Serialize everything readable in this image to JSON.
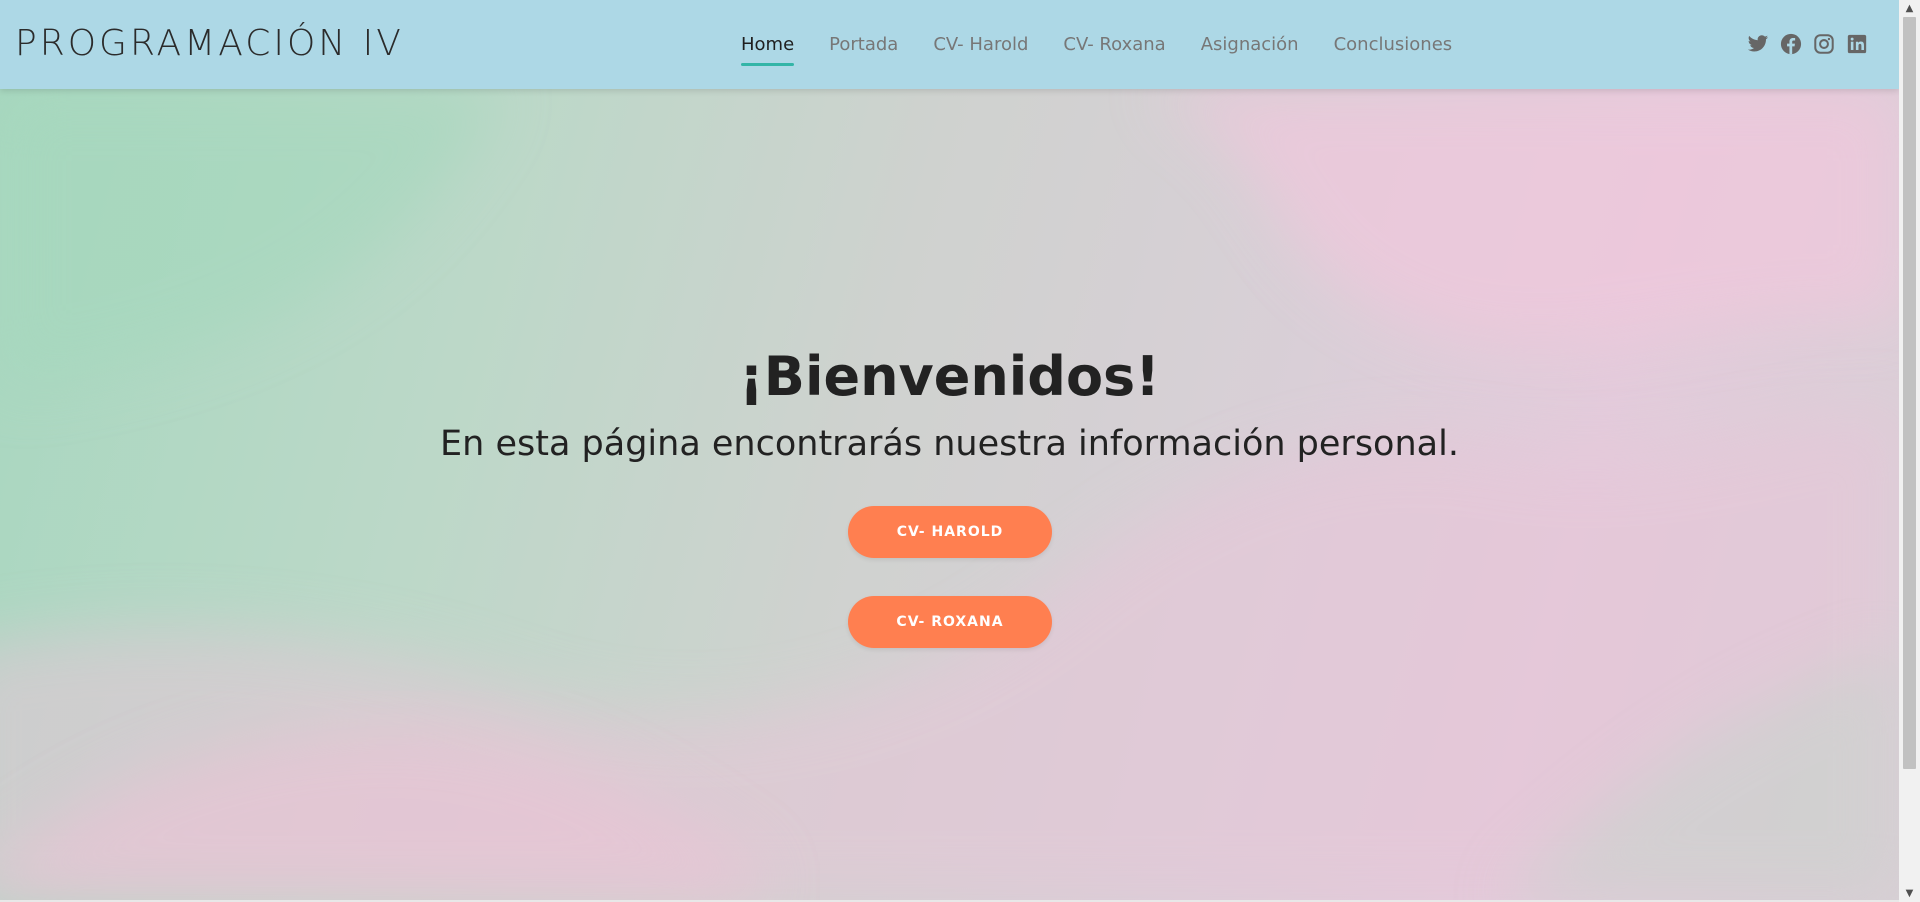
{
  "header": {
    "logo": "PROGRAMACIÓN IV",
    "nav": [
      {
        "label": "Home",
        "active": true
      },
      {
        "label": "Portada",
        "active": false
      },
      {
        "label": "CV- Harold",
        "active": false
      },
      {
        "label": "CV- Roxana",
        "active": false
      },
      {
        "label": "Asignación",
        "active": false
      },
      {
        "label": "Conclusiones",
        "active": false
      }
    ],
    "social_icons": [
      "twitter-icon",
      "facebook-icon",
      "instagram-icon",
      "linkedin-icon"
    ]
  },
  "hero": {
    "title": "¡Bienvenidos!",
    "subtitle": "En esta página encontrarás nuestra información personal.",
    "buttons": [
      {
        "label": "CV- HAROLD"
      },
      {
        "label": "CV- ROXANA"
      }
    ]
  },
  "colors": {
    "header_bg": "#add8e6",
    "accent_underline": "#33b5a7",
    "button_bg": "#ff7f50",
    "button_text": "#ffffff",
    "text_dark": "#222222",
    "nav_text": "#777777"
  }
}
